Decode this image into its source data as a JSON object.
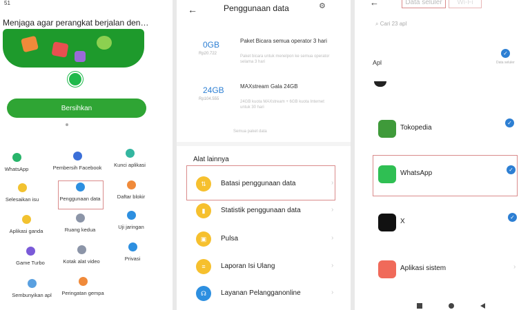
{
  "panel1": {
    "status": "51",
    "title": "Menjaga agar perangkat berjalan den…",
    "clean_button": "Bersihkan",
    "grid": [
      {
        "label": "WhatsApp",
        "color": "#28b46a"
      },
      {
        "label": "Pembersih Facebook",
        "color": "#3b6fd8"
      },
      {
        "label": "Kunci aplikasi",
        "color": "#34b6a0"
      },
      {
        "label": "Selesaikan isu",
        "color": "#f2c230"
      },
      {
        "label": "Penggunaan data",
        "color": "#2d8fe0"
      },
      {
        "label": "Daftar blokir",
        "color": "#f08a3a"
      },
      {
        "label": "Aplikasi ganda",
        "color": "#f2c230"
      },
      {
        "label": "Ruang kedua",
        "color": "#8c95a8"
      },
      {
        "label": "Uji jaringan",
        "color": "#2d8fe0"
      },
      {
        "label": "Game Turbo",
        "color": "#7a5ad8"
      },
      {
        "label": "Kotak alat video",
        "color": "#8c95a8"
      },
      {
        "label": "Privasi",
        "color": "#2d8fe0"
      },
      {
        "label": "Sembunyikan apl",
        "color": "#5aa0e0"
      },
      {
        "label": "Peringatan gempa",
        "color": "#f08a3a"
      }
    ]
  },
  "panel2": {
    "title": "Penggunaan data",
    "packages": [
      {
        "amount": "0GB",
        "price": "Rp20.722",
        "name": "Paket Bicara semua operator 3 hari",
        "desc": "Paket bicara untuk menelpon ke semua operator selama 3 hari"
      },
      {
        "amount": "24GB",
        "price": "Rp104.555",
        "name": "MAXstream Gala 24GB",
        "desc": "24GB kuota MAXstream + 6GB kuota Internet untuk 30 hari"
      }
    ],
    "see_all": "Semua paket data",
    "section_title": "Alat lainnya",
    "tools": [
      {
        "label": "Batasi penggunaan data",
        "glyph": "⇅"
      },
      {
        "label": "Statistik penggunaan data",
        "glyph": "▮"
      },
      {
        "label": "Pulsa",
        "glyph": "▣"
      },
      {
        "label": "Laporan Isi Ulang",
        "glyph": "≡"
      },
      {
        "label": "Layanan Pelangganonline",
        "glyph": "☊"
      }
    ]
  },
  "panel3": {
    "tabs": [
      "Data seluler",
      "Wi-Fi"
    ],
    "search_placeholder": "Cari 23 apl",
    "apps_heading": "Apl",
    "select_all_label": "Data seluler",
    "apps": [
      {
        "label": "Tokopedia",
        "color": "#3f9a3a",
        "checked": true
      },
      {
        "label": "WhatsApp",
        "color": "#2fbf53",
        "checked": true
      },
      {
        "label": "X",
        "color": "#111111",
        "checked": true
      },
      {
        "label": "Aplikasi sistem",
        "color": "#f06a5a",
        "checked": false
      }
    ]
  }
}
